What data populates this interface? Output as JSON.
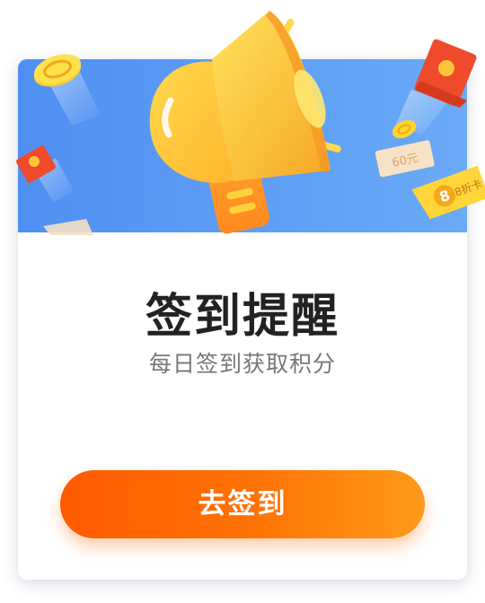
{
  "dialog": {
    "title": "签到提醒",
    "subtitle": "每日签到获取积分",
    "button_label": "去签到"
  },
  "decor": {
    "coupon_label": "60元",
    "coupon_label_small": "60元",
    "ticket_label": "8折卡"
  },
  "colors": {
    "banner_blue": "#5a9af4",
    "button_orange_start": "#ff5a00",
    "button_orange_end": "#ff9a1a",
    "megaphone_yellow": "#ffc93a",
    "envelope_red": "#f04a2a",
    "title_text": "#222222",
    "subtitle_text": "#777777"
  }
}
